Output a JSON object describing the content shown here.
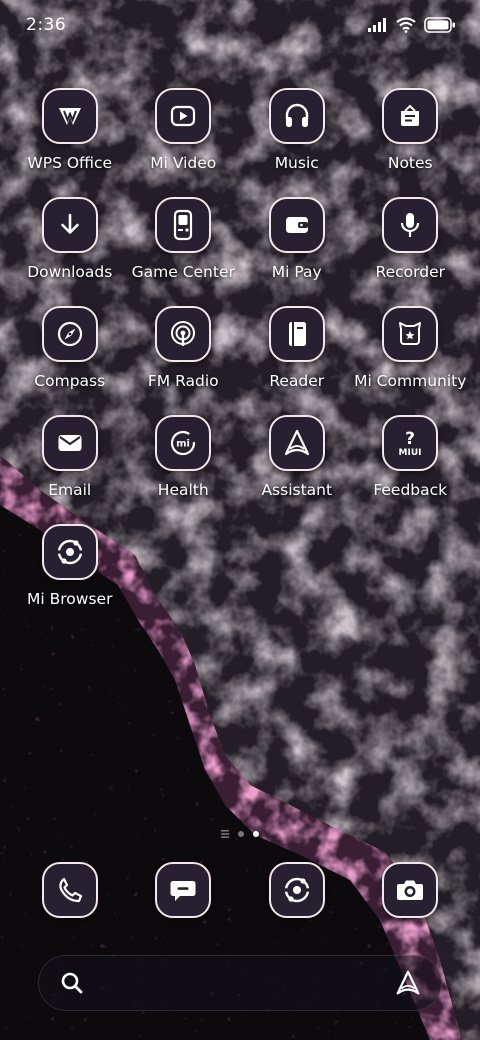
{
  "status_bar": {
    "time": "2:36"
  },
  "apps": [
    {
      "label": "WPS Office",
      "icon": "wps-office-icon"
    },
    {
      "label": "Mi Video",
      "icon": "play-icon"
    },
    {
      "label": "Music",
      "icon": "headphones-icon"
    },
    {
      "label": "Notes",
      "icon": "notes-icon"
    },
    {
      "label": "Downloads",
      "icon": "download-arrow-icon"
    },
    {
      "label": "Game Center",
      "icon": "gamepad-icon"
    },
    {
      "label": "Mi Pay",
      "icon": "wallet-icon"
    },
    {
      "label": "Recorder",
      "icon": "microphone-icon"
    },
    {
      "label": "Compass",
      "icon": "compass-icon"
    },
    {
      "label": "FM Radio",
      "icon": "radio-icon"
    },
    {
      "label": "Reader",
      "icon": "book-icon"
    },
    {
      "label": "Mi Community",
      "icon": "community-icon"
    },
    {
      "label": "Email",
      "icon": "envelope-icon"
    },
    {
      "label": "Health",
      "icon": "health-ring-icon"
    },
    {
      "label": "Assistant",
      "icon": "assistant-icon"
    },
    {
      "label": "Feedback",
      "icon": "feedback-icon"
    },
    {
      "label": "Mi Browser",
      "icon": "browser-icon"
    }
  ],
  "feedback_icon_text": {
    "mark": "?",
    "brand": "MIUI"
  },
  "health_icon_text": "mi",
  "dock": [
    {
      "app": "phone",
      "icon": "phone-icon"
    },
    {
      "app": "messaging",
      "icon": "message-bubble-icon"
    },
    {
      "app": "browser",
      "icon": "browser-icon"
    },
    {
      "app": "camera",
      "icon": "camera-icon"
    }
  ],
  "page_indicator": {
    "pages": 2,
    "current": 2
  },
  "search_bar": {
    "left_icon": "search-icon",
    "right_icon": "assistant-icon"
  },
  "colors": {
    "icon_bg": "#262031",
    "icon_border": "#f2e7ea",
    "foam_pink": "#d05a9a"
  }
}
